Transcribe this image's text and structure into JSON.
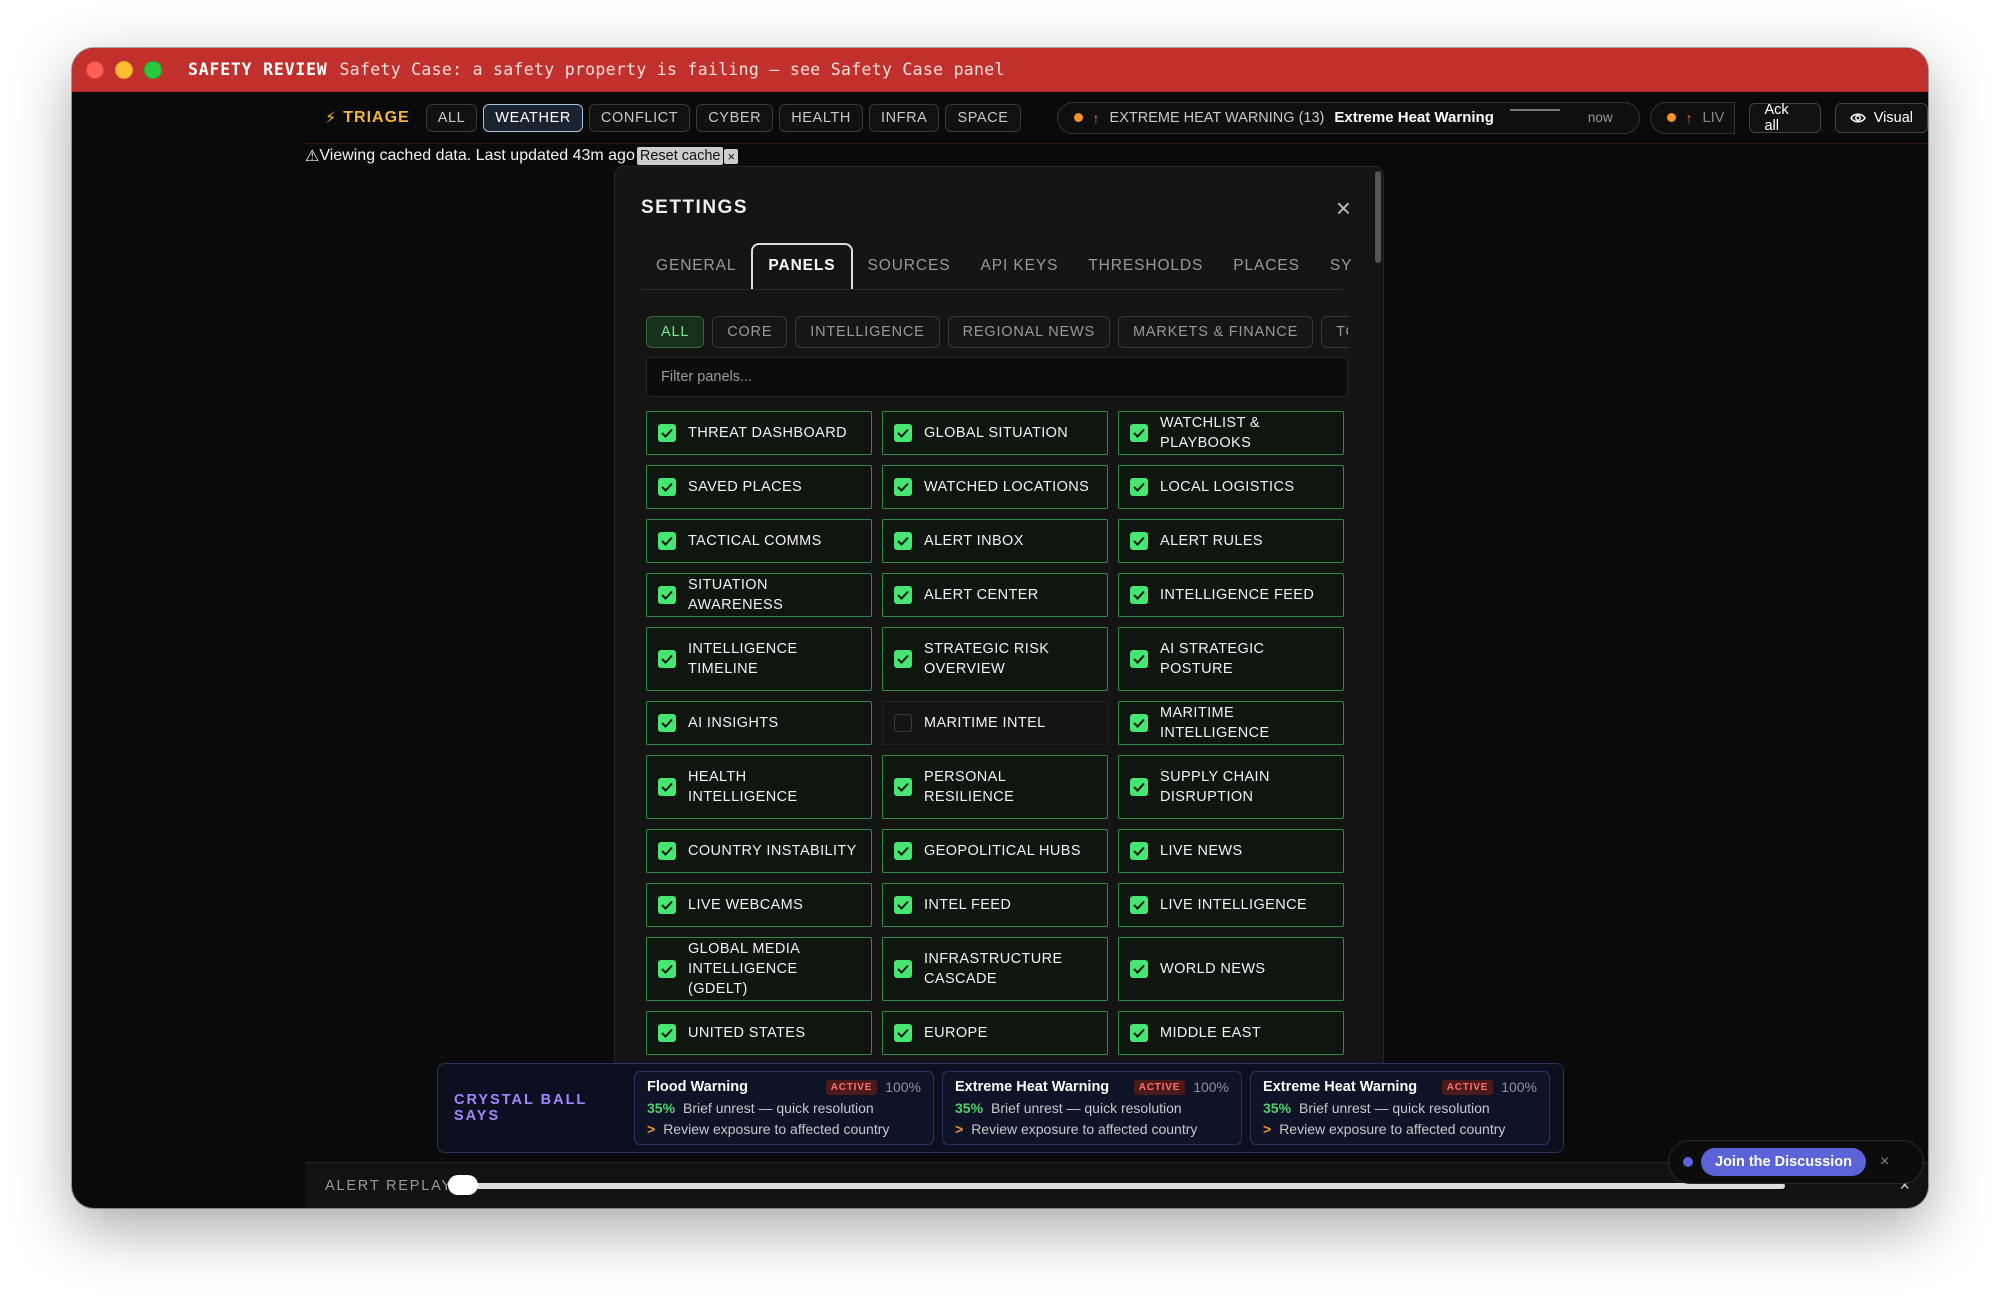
{
  "titlebar": {
    "label": "SAFETY REVIEW",
    "message": "Safety Case: a safety property is failing — see Safety Case panel"
  },
  "triage": {
    "label": "TRIAGE",
    "tabs": [
      "ALL",
      "WEATHER",
      "CONFLICT",
      "CYBER",
      "HEALTH",
      "INFRA",
      "SPACE"
    ],
    "active_tab": "WEATHER",
    "alert": {
      "category": "EXTREME HEAT WARNING (13)",
      "title": "Extreme Heat Warning",
      "time": "now"
    },
    "live_label": "LIV",
    "ack_all": "Ack all",
    "visual": "Visual"
  },
  "cached": {
    "text": "Viewing cached data. Last updated 43m ago",
    "reset": "Reset cache",
    "close": "×"
  },
  "settings": {
    "title": "SETTINGS",
    "tabs": [
      "GENERAL",
      "PANELS",
      "SOURCES",
      "API KEYS",
      "THRESHOLDS",
      "PLACES",
      "SYSTEM"
    ],
    "active_tab": "PANELS",
    "chips": [
      "ALL",
      "CORE",
      "INTELLIGENCE",
      "REGIONAL NEWS",
      "MARKETS & FINANCE",
      "TOOLS"
    ],
    "active_chip": "ALL",
    "filter_placeholder": "Filter panels...",
    "panels": [
      {
        "label": "THREAT DASHBOARD",
        "checked": true
      },
      {
        "label": "GLOBAL SITUATION",
        "checked": true
      },
      {
        "label": "WATCHLIST & PLAYBOOKS",
        "checked": true
      },
      {
        "label": "SAVED PLACES",
        "checked": true
      },
      {
        "label": "WATCHED LOCATIONS",
        "checked": true
      },
      {
        "label": "LOCAL LOGISTICS",
        "checked": true
      },
      {
        "label": "TACTICAL COMMS",
        "checked": true
      },
      {
        "label": "ALERT INBOX",
        "checked": true
      },
      {
        "label": "ALERT RULES",
        "checked": true
      },
      {
        "label": "SITUATION AWARENESS",
        "checked": true
      },
      {
        "label": "ALERT CENTER",
        "checked": true
      },
      {
        "label": "INTELLIGENCE FEED",
        "checked": true
      },
      {
        "label": "INTELLIGENCE TIMELINE",
        "checked": true
      },
      {
        "label": "STRATEGIC RISK OVERVIEW",
        "checked": true
      },
      {
        "label": "AI STRATEGIC POSTURE",
        "checked": true
      },
      {
        "label": "AI INSIGHTS",
        "checked": true
      },
      {
        "label": "MARITIME INTEL",
        "checked": false
      },
      {
        "label": "MARITIME INTELLIGENCE",
        "checked": true
      },
      {
        "label": "HEALTH INTELLIGENCE",
        "checked": true
      },
      {
        "label": "PERSONAL RESILIENCE",
        "checked": true
      },
      {
        "label": "SUPPLY CHAIN DISRUPTION",
        "checked": true
      },
      {
        "label": "COUNTRY INSTABILITY",
        "checked": true
      },
      {
        "label": "GEOPOLITICAL HUBS",
        "checked": true
      },
      {
        "label": "LIVE NEWS",
        "checked": true
      },
      {
        "label": "LIVE WEBCAMS",
        "checked": true
      },
      {
        "label": "INTEL FEED",
        "checked": true
      },
      {
        "label": "LIVE INTELLIGENCE",
        "checked": true
      },
      {
        "label": "GLOBAL MEDIA INTELLIGENCE (GDELT)",
        "checked": true
      },
      {
        "label": "INFRASTRUCTURE CASCADE",
        "checked": true
      },
      {
        "label": "WORLD NEWS",
        "checked": true
      },
      {
        "label": "UNITED STATES",
        "checked": true
      },
      {
        "label": "EUROPE",
        "checked": true
      },
      {
        "label": "MIDDLE EAST",
        "checked": true
      }
    ]
  },
  "crystal_ball": {
    "label": "CRYSTAL BALL SAYS",
    "cards": [
      {
        "title": "Flood Warning",
        "badge": "ACTIVE",
        "confidence": "100%",
        "probability": "35%",
        "outcome": "Brief unrest — quick resolution",
        "action": "Review exposure to affected country"
      },
      {
        "title": "Extreme Heat Warning",
        "badge": "ACTIVE",
        "confidence": "100%",
        "probability": "35%",
        "outcome": "Brief unrest — quick resolution",
        "action": "Review exposure to affected country"
      },
      {
        "title": "Extreme Heat Warning",
        "badge": "ACTIVE",
        "confidence": "100%",
        "probability": "35%",
        "outcome": "Brief unrest — quick resolution",
        "action": "Review exposure to affected country"
      }
    ]
  },
  "replay": {
    "label": "ALERT REPLAY",
    "close": "×"
  },
  "discussion": {
    "button": "Join the Discussion",
    "close": "×"
  },
  "colors": {
    "titlebar_bg": "#c2302d",
    "triage_accent": "#f4b63a",
    "checkbox_green": "#47e672",
    "panel_border": "#2f8a45",
    "crystal_accent": "#a087ff",
    "discussion_button": "#5a64d8"
  }
}
